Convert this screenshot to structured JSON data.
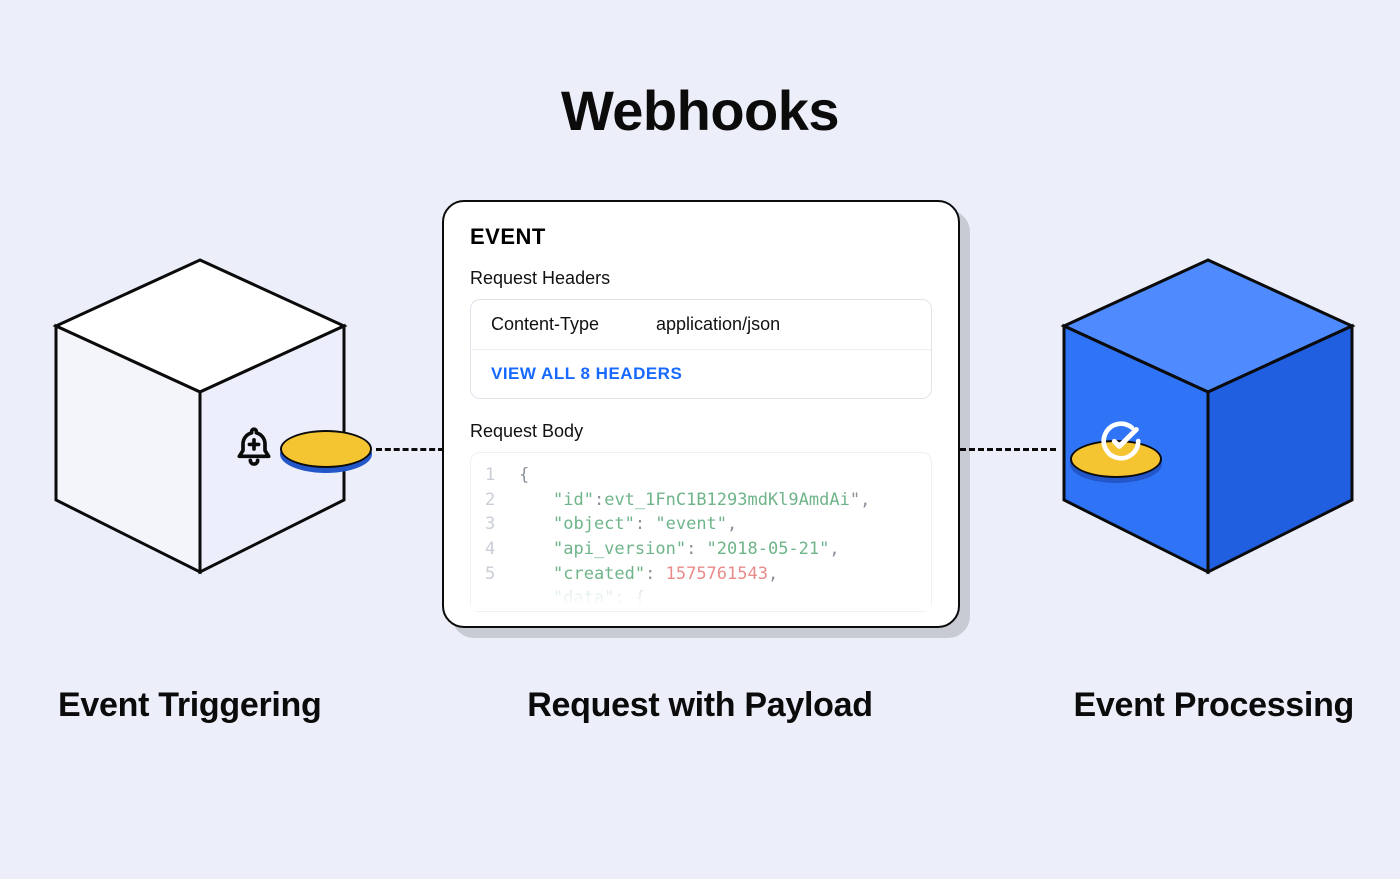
{
  "title": "Webhooks",
  "captions": {
    "left": "Event Triggering",
    "center": "Request with Payload",
    "right": "Event Processing"
  },
  "card": {
    "heading": "EVENT",
    "request_headers_label": "Request Headers",
    "header_key": "Content-Type",
    "header_value": "application/json",
    "view_all_label": "VIEW ALL 8 HEADERS",
    "request_body_label": "Request Body",
    "code_lines": {
      "l1_num": "1",
      "l1_text": "{",
      "l2_num": "2",
      "l2_key": "\"id\"",
      "l2_val": "evt_1FnC1B1293mdKl9AmdAi",
      "l3_num": "3",
      "l3_key": "\"object\"",
      "l3_val": "\"event\"",
      "l4_num": "4",
      "l4_key": "\"api_version\"",
      "l4_val": "\"2018-05-21\"",
      "l5_num": "5",
      "l5_key": "\"created\"",
      "l5_val": "1575761543",
      "l6_key": "\"data\"",
      "l6_tail": ": {"
    }
  },
  "colors": {
    "accent_blue": "#1869ff",
    "cube_blue": "#2f74f6",
    "coin_yellow": "#f5c431"
  },
  "icons": {
    "left_cube_icon": "bell-plus-icon",
    "right_cube_icon": "check-circle-icon"
  }
}
